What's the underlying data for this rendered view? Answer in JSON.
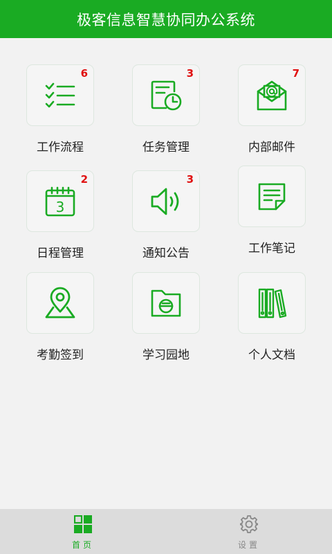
{
  "header": {
    "title": "极客信息智慧协同办公系统"
  },
  "colors": {
    "primary": "#1aab23",
    "badge": "#e01010",
    "inactive": "#888888"
  },
  "tiles": [
    {
      "label": "工作流程",
      "badge": "6",
      "icon": "checklist-icon"
    },
    {
      "label": "任务管理",
      "badge": "3",
      "icon": "task-clock-icon"
    },
    {
      "label": "内部邮件",
      "badge": "7",
      "icon": "mail-icon"
    },
    {
      "label": "日程管理",
      "badge": "2",
      "icon": "calendar-icon"
    },
    {
      "label": "通知公告",
      "badge": "3",
      "icon": "speaker-icon"
    },
    {
      "label": "工作笔记",
      "badge": "",
      "icon": "note-icon"
    },
    {
      "label": "考勤签到",
      "badge": "",
      "icon": "location-pin-icon"
    },
    {
      "label": "学习园地",
      "badge": "",
      "icon": "folder-icon"
    },
    {
      "label": "个人文档",
      "badge": "",
      "icon": "binders-icon"
    }
  ],
  "tabbar": {
    "home": {
      "label": "首页",
      "icon": "grid-icon"
    },
    "settings": {
      "label": "设置",
      "icon": "gear-icon"
    }
  }
}
